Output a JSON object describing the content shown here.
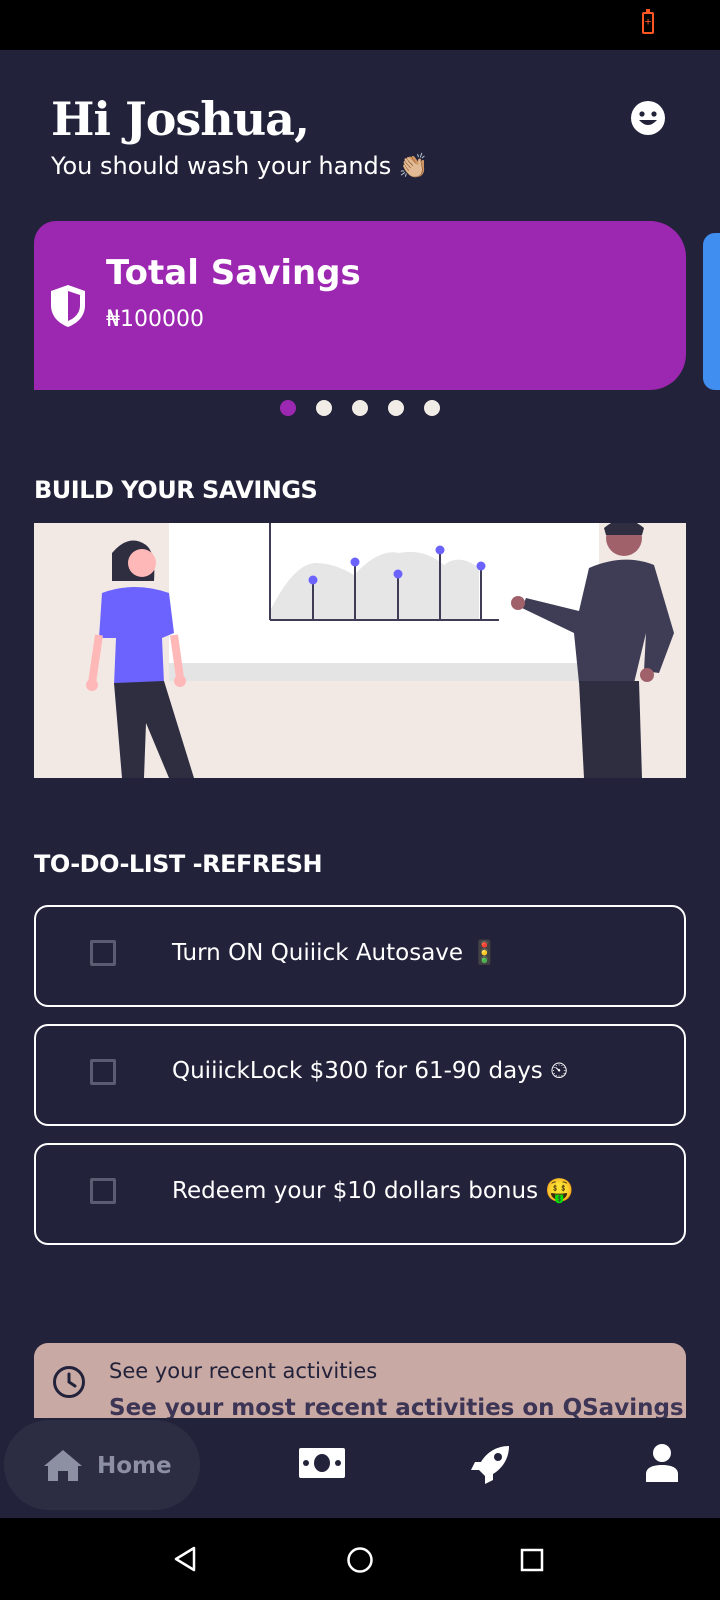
{
  "status_bar": {
    "battery_icon": "battery-charging-icon"
  },
  "header": {
    "greeting": "Hi Joshua,",
    "subtitle": "You should wash your hands 👏🏼",
    "profile_icon": "smiley-icon"
  },
  "savings_card": {
    "title": "Total Savings",
    "amount": "₦100000",
    "icon": "shield-icon",
    "color": "#9c27b0"
  },
  "carousel": {
    "count": 5,
    "active_index": 0,
    "active_color": "#9c27b0"
  },
  "build_section": {
    "title": "BUILD YOUR SAVINGS"
  },
  "todo_section": {
    "title": "TO-DO-LIST -REFRESH",
    "items": [
      {
        "label": "Turn ON Quiiick Autosave 🚦",
        "checked": false
      },
      {
        "label": "QuiiickLock $300 for 61-90 days ⏲",
        "checked": false
      },
      {
        "label": "Redeem your $10 dollars bonus 🤑",
        "checked": false
      }
    ]
  },
  "activity_card": {
    "title": "See your recent activities",
    "subtitle": "See your most recent activities on QSavings"
  },
  "bottom_nav": {
    "items": [
      {
        "label": "Home",
        "icon": "home-icon",
        "active": true
      },
      {
        "label": "",
        "icon": "money-icon",
        "active": false
      },
      {
        "label": "",
        "icon": "rocket-icon",
        "active": false
      },
      {
        "label": "",
        "icon": "user-icon",
        "active": false
      }
    ]
  },
  "system_nav": {
    "icons": [
      "back-icon",
      "home-circle-icon",
      "recents-icon"
    ]
  },
  "colors": {
    "background": "#22223b",
    "card_accent": "#9c27b0",
    "illustration_bg": "#f2e9e5"
  }
}
